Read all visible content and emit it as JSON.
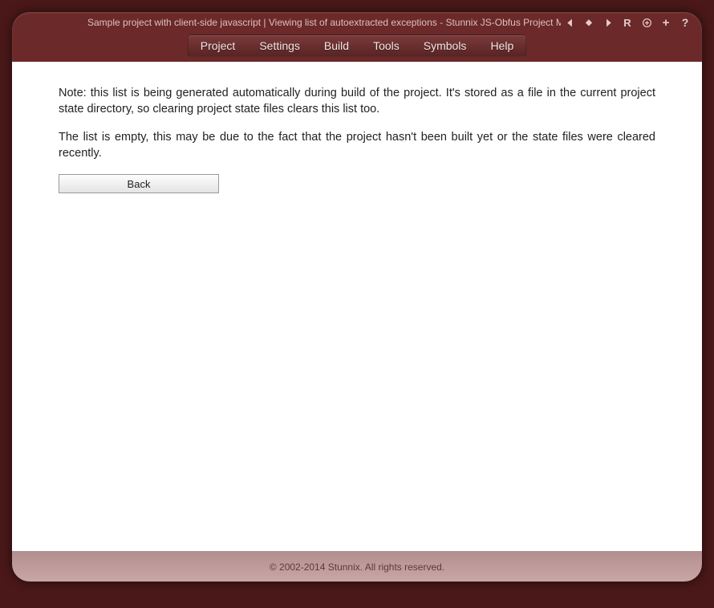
{
  "titlebar": {
    "text": "Sample project with client-side javascript | Viewing list of autoextracted exceptions - Stunnix JS-Obfus Project Ma"
  },
  "menu": {
    "items": [
      "Project",
      "Settings",
      "Build",
      "Tools",
      "Symbols",
      "Help"
    ]
  },
  "content": {
    "note1": "Note: this list is being generated automatically during build of the project. It's stored as a file in the current project state directory, so clearing project state files clears this list too.",
    "note2": "The list is empty, this may be due to the fact that the project hasn't been built yet or the state files were cleared recently.",
    "back_label": "Back"
  },
  "footer": {
    "copyright": "© 2002-2014 Stunnix. All rights reserved."
  }
}
